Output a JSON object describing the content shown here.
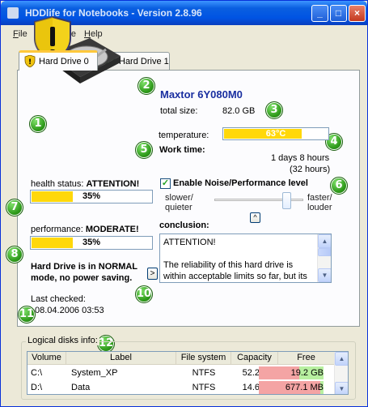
{
  "window": {
    "title": "HDDlife for Notebooks - Version 2.8.96",
    "controls": {
      "minimize": "_",
      "maximize": "□",
      "close": "×"
    }
  },
  "menu": [
    {
      "label": "File",
      "underline": "F",
      "rest": "ile"
    },
    {
      "label": "Language",
      "underline": "L",
      "rest": "anguage"
    },
    {
      "label": "Help",
      "underline": "H",
      "rest": "elp"
    }
  ],
  "tabs": [
    {
      "label": "Hard Drive 0",
      "icon": "shield-warning-icon",
      "active": true
    },
    {
      "label": "Hard Drive 1",
      "icon": "shield-ok-icon",
      "active": false
    }
  ],
  "drive": {
    "model": "Maxtor 6Y080M0",
    "total_size_label": "total size:",
    "total_size": "82.0 GB",
    "temperature_label": "temperature:",
    "temperature": "63°C",
    "temperature_level": 0.75,
    "work_time_label": "Work time:",
    "work_time": "1 days 8 hours",
    "work_time_hours": "(32 hours)"
  },
  "health": {
    "label": "health status:",
    "value": "ATTENTION!",
    "percent_text": "35%",
    "level": 0.35
  },
  "noise": {
    "checkbox_label": "Enable Noise/Performance level",
    "checked": true,
    "slower_label": "slower/\nquieter",
    "faster_label": "faster/\nlouder",
    "level": 0.85,
    "collapse_button": "^"
  },
  "performance": {
    "label": "performance:",
    "value": "MODERATE!",
    "percent_text": "35%",
    "level": 0.35
  },
  "mode": {
    "text_line1": "Hard Drive is in NORMAL",
    "text_line2": "mode, no power saving.",
    "button": ">"
  },
  "conclusion": {
    "label": "conclusion:",
    "text_line1": "ATTENTION!",
    "text_line2": "",
    "text_line3": "The reliability of this hard drive is",
    "text_line4": "within acceptable limits so far, but its"
  },
  "last_checked": {
    "label": "Last checked:",
    "value": "08.04.2006 03:53"
  },
  "logical": {
    "title": "Logical disks info:",
    "columns": [
      "Volume",
      "Label",
      "File system",
      "Capacity",
      "Free"
    ],
    "rows": [
      {
        "volume": "C:\\",
        "label": "System_XP",
        "fs": "NTFS",
        "capacity": "52.2 GB",
        "free": "19.2 GB",
        "free_fraction": 0.37
      },
      {
        "volume": "D:\\",
        "label": "Data",
        "fs": "NTFS",
        "capacity": "14.6 GB",
        "free": "677.1 MB",
        "free_fraction": 0.05
      }
    ]
  },
  "callouts": [
    "1",
    "2",
    "3",
    "4",
    "5",
    "6",
    "7",
    "8",
    "9",
    "10",
    "11",
    "12"
  ],
  "colors": {
    "accent": "#1a2fa0",
    "bar": "#ffd80a",
    "callout": "#2e9a1a"
  }
}
